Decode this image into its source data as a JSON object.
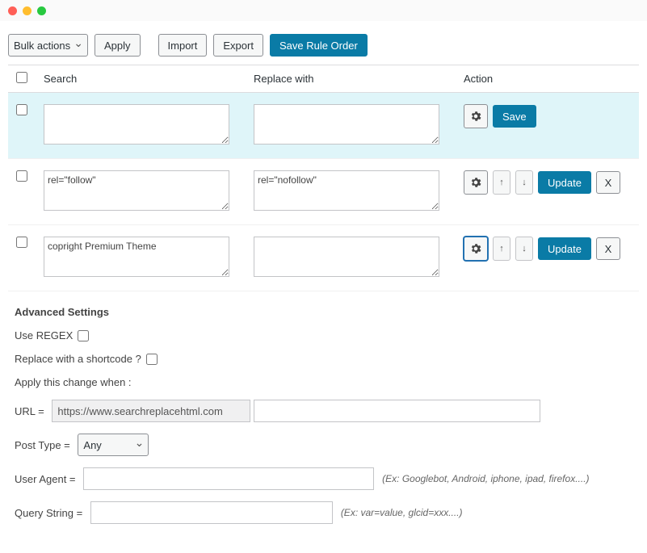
{
  "toolbar": {
    "bulk_label": "Bulk actions",
    "apply_label": "Apply",
    "import_label": "Import",
    "export_label": "Export",
    "save_order_label": "Save Rule Order"
  },
  "table": {
    "headers": {
      "search": "Search",
      "replace": "Replace with",
      "action": "Action"
    },
    "rows": [
      {
        "search": "",
        "replace": "",
        "highlight": true,
        "action_label": "Save",
        "show_order": false,
        "show_del": false,
        "gear_focus": false
      },
      {
        "search": "rel=\"follow\"",
        "replace": "rel=\"nofollow\"",
        "highlight": false,
        "action_label": "Update",
        "show_order": true,
        "show_del": true,
        "gear_focus": false
      },
      {
        "search": "copright Premium Theme",
        "replace": "",
        "highlight": false,
        "action_label": "Update",
        "show_order": true,
        "show_del": true,
        "gear_focus": true
      }
    ],
    "up_icon": "↑",
    "down_icon": "↓",
    "del_label": "X"
  },
  "advanced": {
    "title": "Advanced Settings",
    "use_regex": "Use REGEX",
    "replace_shortcode": "Replace with a shortcode ?",
    "apply_when": "Apply this change when :",
    "url_label": "URL =",
    "url_value": "https://www.searchreplacehtml.com",
    "post_type_label": "Post Type =",
    "post_type_value": "Any",
    "user_agent_label": "User Agent =",
    "user_agent_hint": "(Ex: Googlebot, Android, iphone, ipad, firefox....)",
    "query_string_label": "Query String =",
    "query_string_hint": "(Ex: var=value, glcid=xxx....)"
  }
}
